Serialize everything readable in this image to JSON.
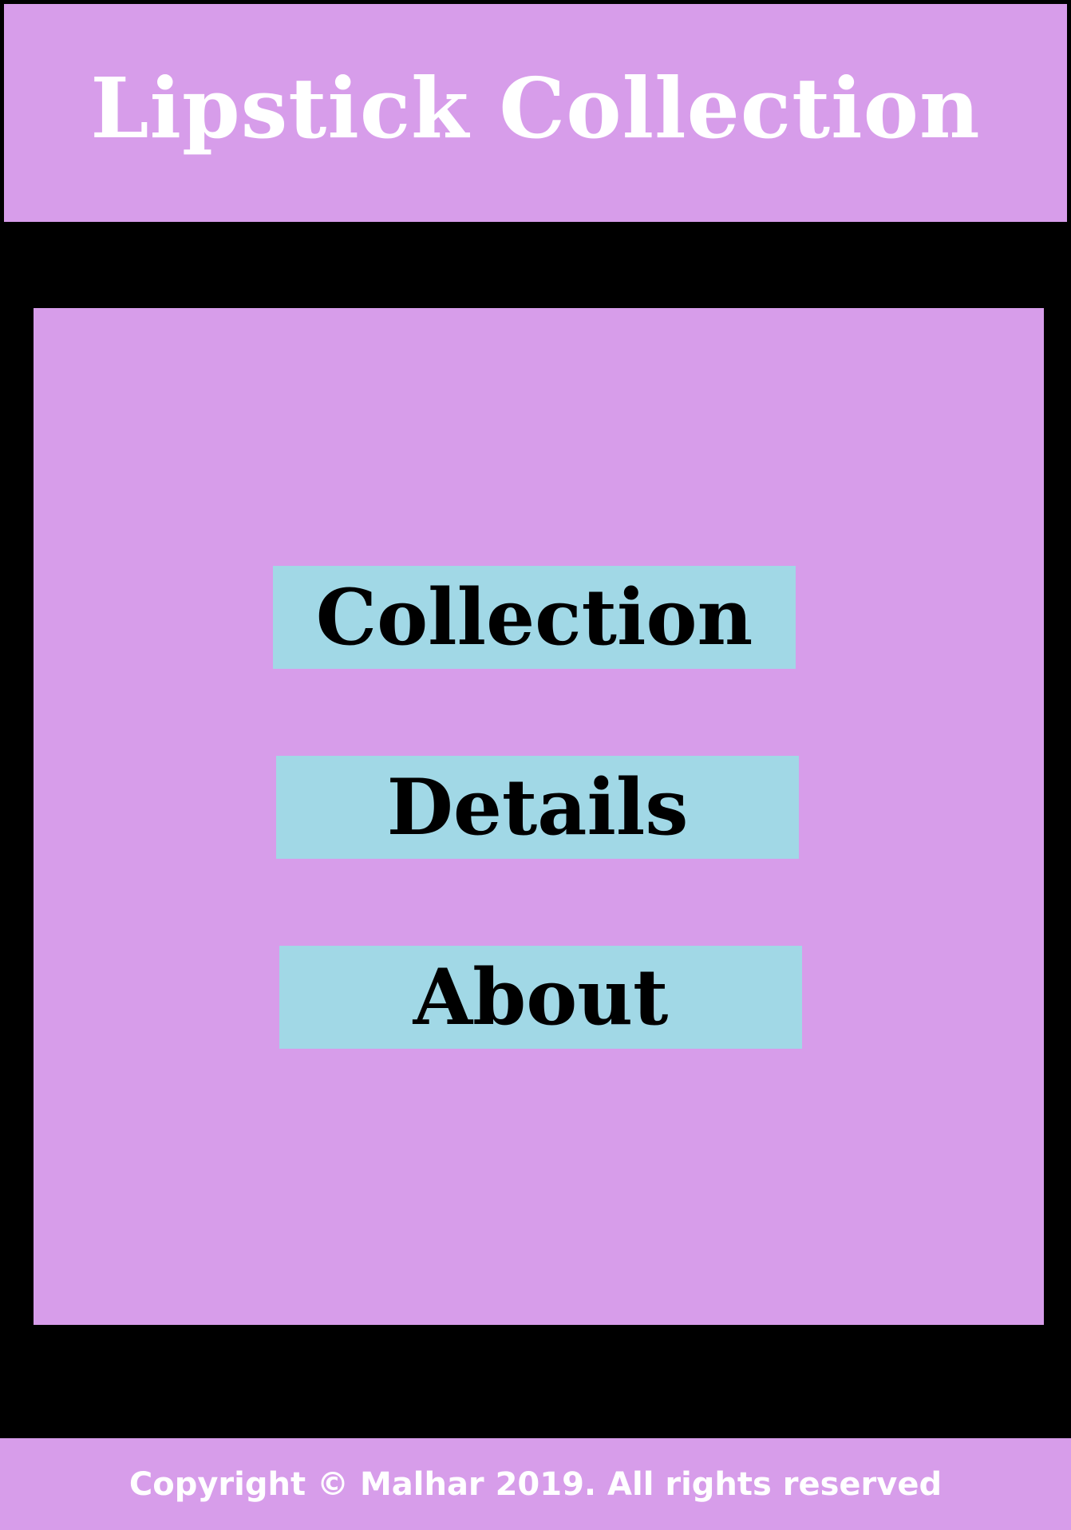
{
  "header": {
    "title": "Lipstick Collection"
  },
  "nav": {
    "items": [
      {
        "label": "Collection"
      },
      {
        "label": "Details"
      },
      {
        "label": "About"
      }
    ]
  },
  "footer": {
    "copyright": "Copyright © Malhar 2019. All rights reserved"
  },
  "colors": {
    "panel": "#d79dea",
    "button": "#a1d8e6",
    "frame": "#000000",
    "title_text": "#ffffff",
    "button_text": "#000000"
  }
}
